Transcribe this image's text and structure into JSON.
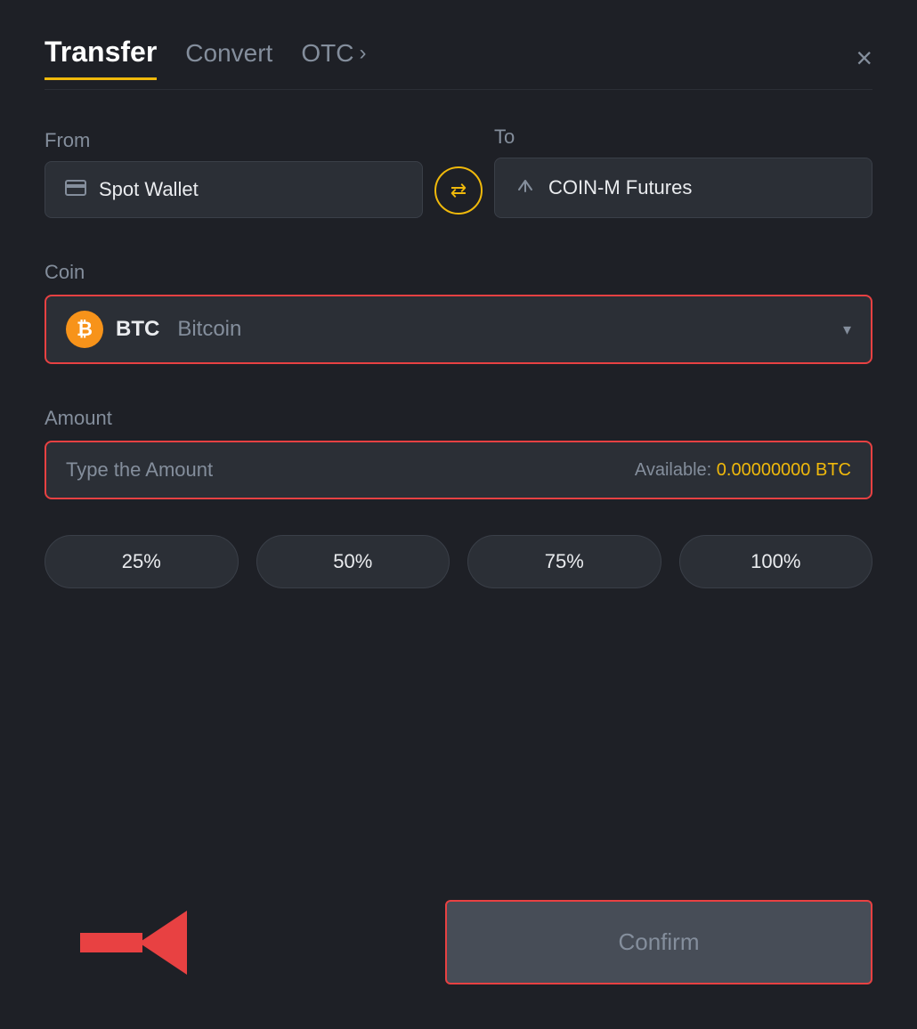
{
  "header": {
    "tab_transfer": "Transfer",
    "tab_convert": "Convert",
    "tab_otc": "OTC",
    "tab_otc_chevron": "›",
    "close_label": "×"
  },
  "from_section": {
    "label": "From",
    "wallet_name": "Spot Wallet"
  },
  "to_section": {
    "label": "To",
    "wallet_name": "COIN-M Futures"
  },
  "swap": {
    "icon": "⇄"
  },
  "coin_section": {
    "label": "Coin",
    "coin_symbol": "BTC",
    "coin_name": "Bitcoin",
    "chevron": "▾"
  },
  "amount_section": {
    "label": "Amount",
    "placeholder": "Type the Amount",
    "available_label": "Available:",
    "available_value": "0.00000000 BTC"
  },
  "pct_buttons": [
    {
      "label": "25%"
    },
    {
      "label": "50%"
    },
    {
      "label": "75%"
    },
    {
      "label": "100%"
    }
  ],
  "confirm_button": {
    "label": "Confirm"
  }
}
